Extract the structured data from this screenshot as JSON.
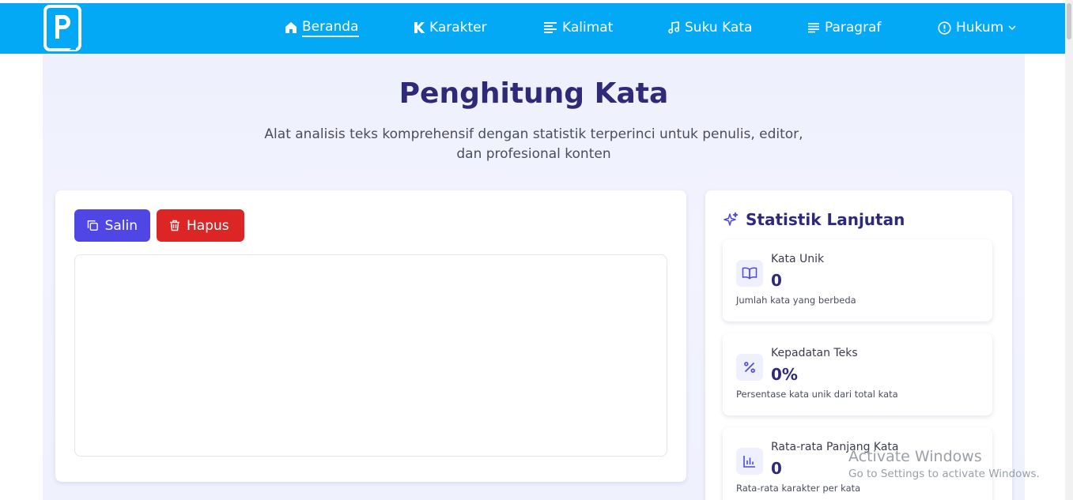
{
  "nav": {
    "items": [
      {
        "label": "Beranda",
        "icon": "home-icon",
        "active": true
      },
      {
        "label": "Karakter",
        "icon": "k-letter-icon"
      },
      {
        "label": "Kalimat",
        "icon": "text-lines-icon"
      },
      {
        "label": "Suku Kata",
        "icon": "music-note-icon"
      },
      {
        "label": "Paragraf",
        "icon": "paragraph-icon"
      },
      {
        "label": "Hukum",
        "icon": "info-circle-icon",
        "dropdown": true
      }
    ]
  },
  "header": {
    "title": "Penghitung Kata",
    "subtitle": "Alat analisis teks komprehensif dengan statistik terperinci untuk penulis, editor, dan profesional konten"
  },
  "editor": {
    "copy_label": "Salin",
    "delete_label": "Hapus",
    "text_value": ""
  },
  "stats": {
    "title": "Statistik Lanjutan",
    "items": [
      {
        "label": "Kata Unik",
        "value": "0",
        "desc": "Jumlah kata yang berbeda",
        "icon": "book-open-icon"
      },
      {
        "label": "Kepadatan Teks",
        "value": "0%",
        "desc": "Persentase kata unik dari total kata",
        "icon": "percent-icon"
      },
      {
        "label": "Rata-rata Panjang Kata",
        "value": "0",
        "desc": "Rata-rata karakter per kata",
        "icon": "bar-chart-icon"
      }
    ]
  },
  "watermark": {
    "line1": "Activate Windows",
    "line2": "Go to Settings to activate Windows."
  },
  "colors": {
    "navbar": "#03a9f4",
    "primary": "#4f46e5",
    "danger": "#dc2626",
    "title": "#2f2a78"
  }
}
